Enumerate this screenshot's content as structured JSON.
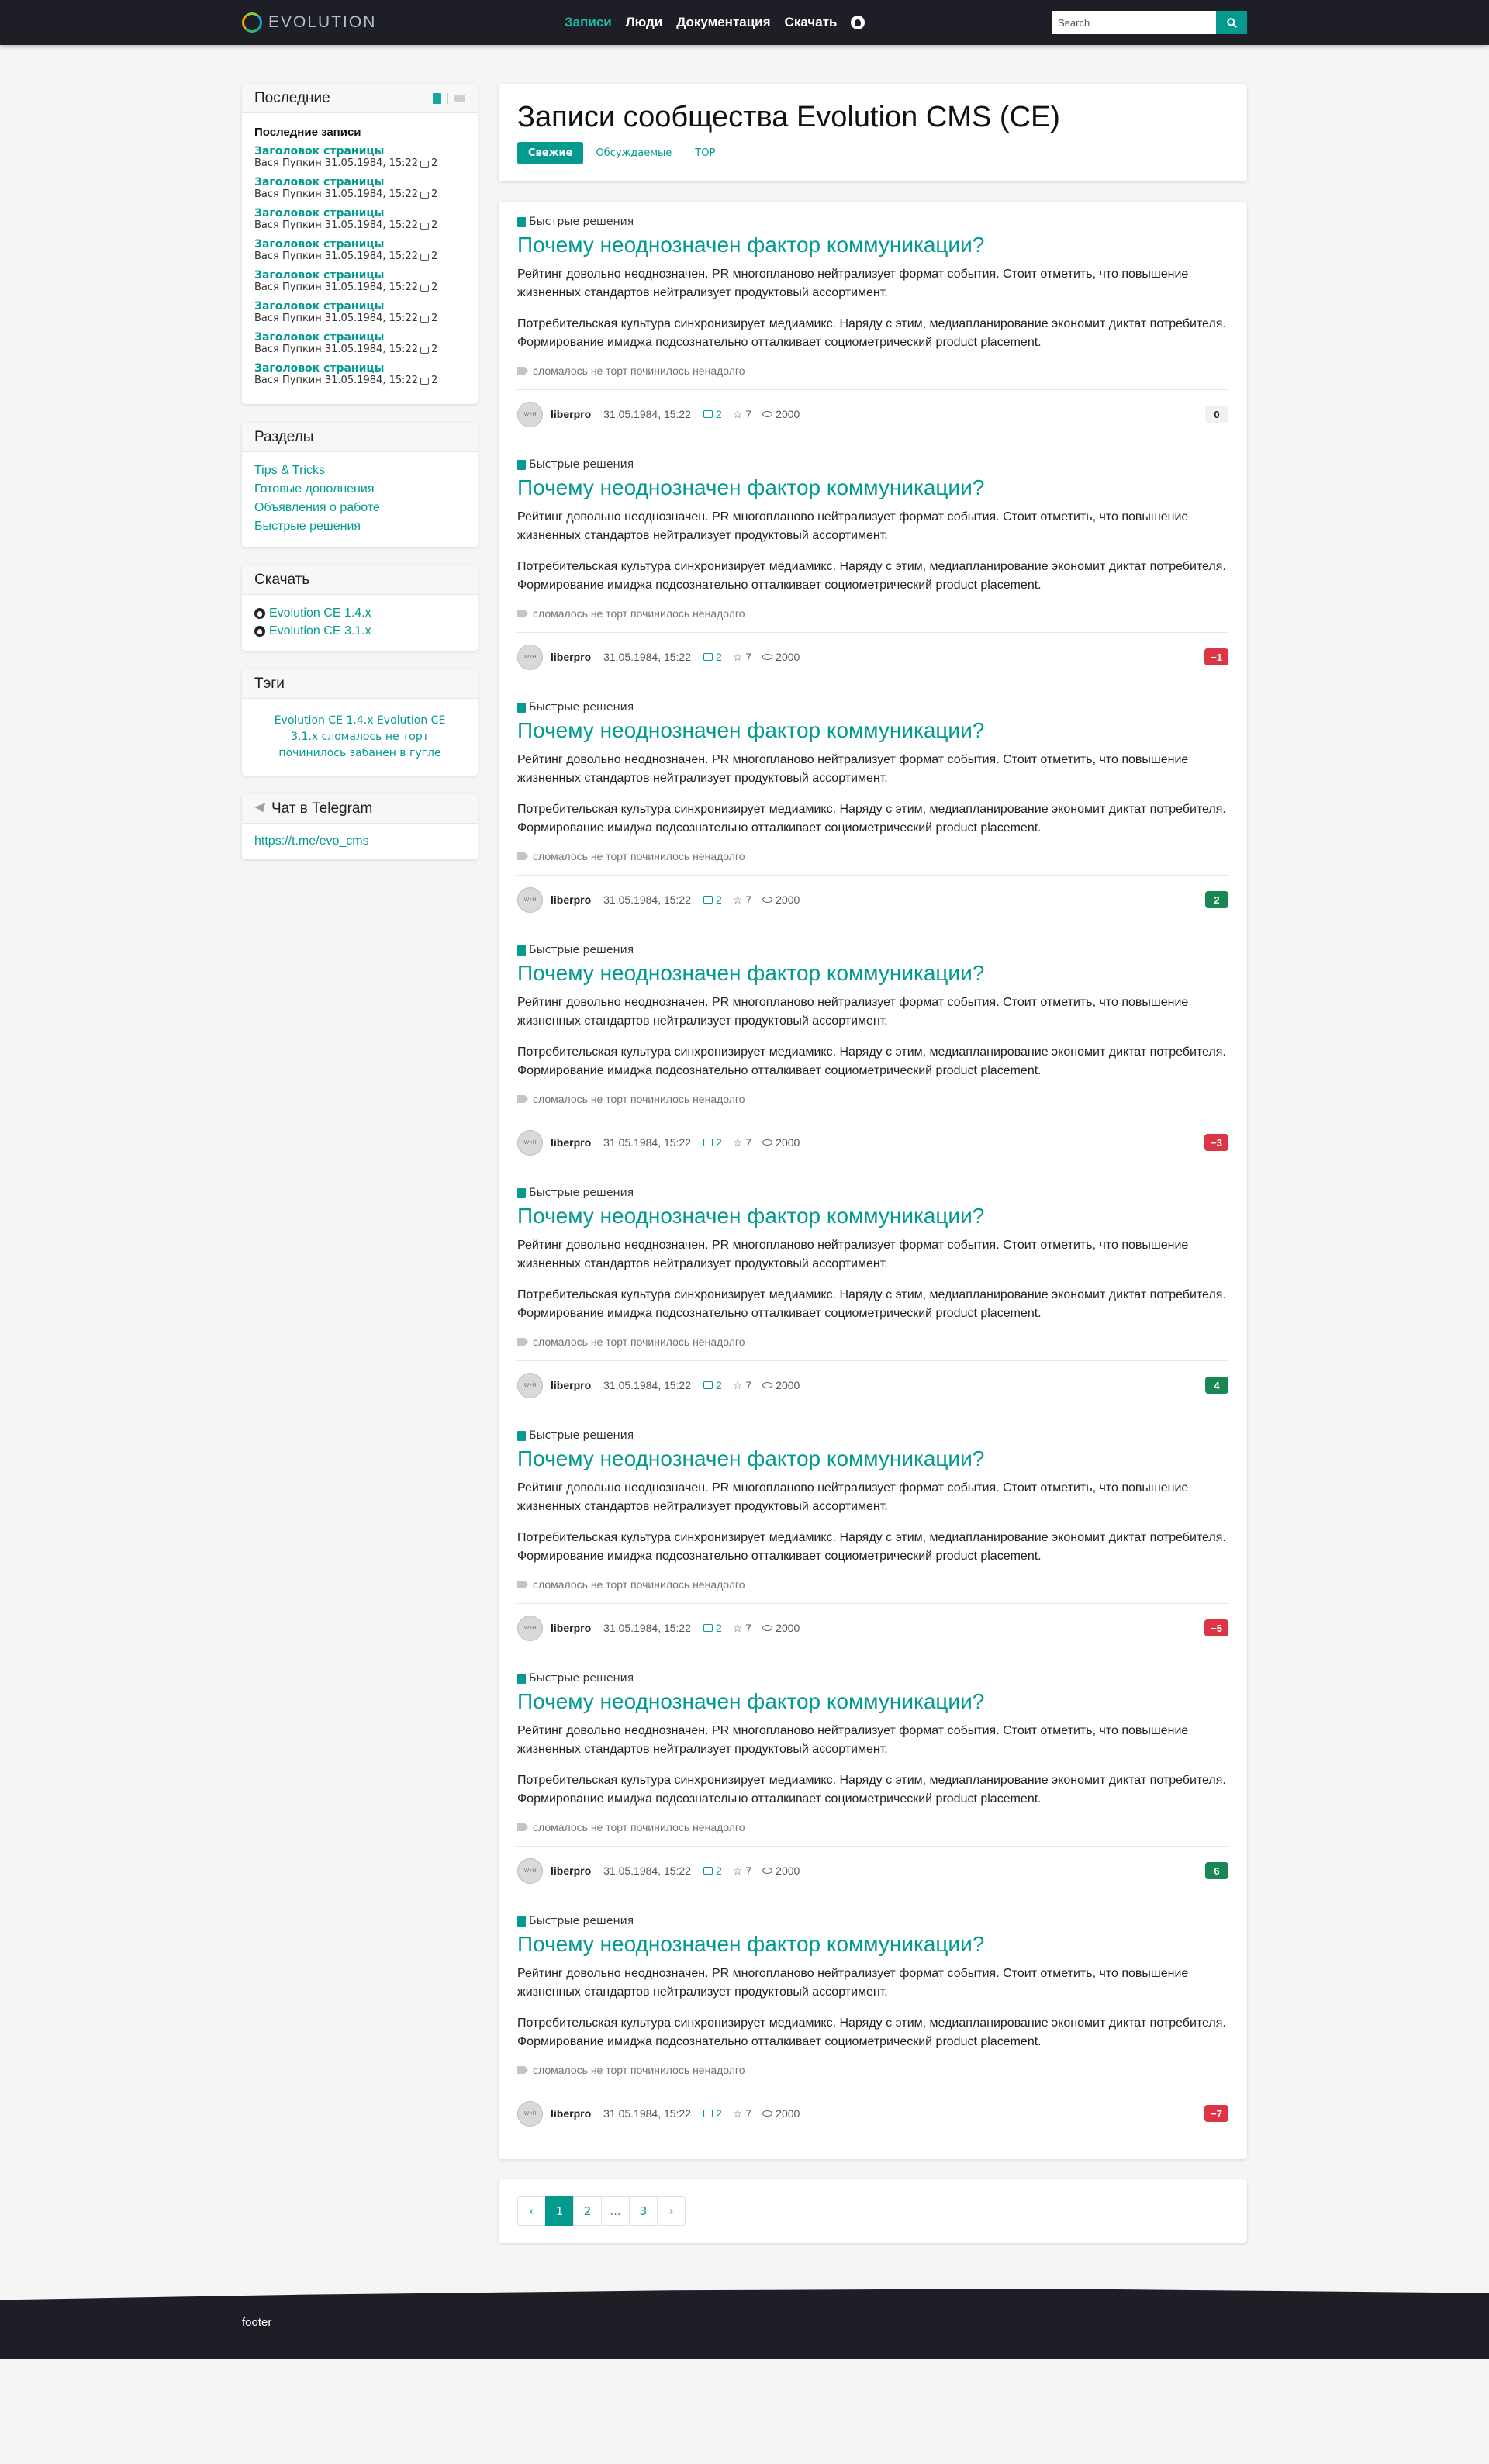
{
  "nav": {
    "logo_text": "EVOLUTION",
    "links": [
      "Записи",
      "Люди",
      "Документация",
      "Скачать"
    ],
    "active_link": "Записи",
    "search_placeholder": "Search"
  },
  "sidebar": {
    "recent": {
      "title": "Последние",
      "subtitle": "Последние записи",
      "items": [
        {
          "title": "Заголовок страницы",
          "meta": "Вася Пупкин 31.05.1984, 15:22",
          "comments": "2"
        },
        {
          "title": "Заголовок страницы",
          "meta": "Вася Пупкин 31.05.1984, 15:22",
          "comments": "2"
        },
        {
          "title": "Заголовок страницы",
          "meta": "Вася Пупкин 31.05.1984, 15:22",
          "comments": "2"
        },
        {
          "title": "Заголовок страницы",
          "meta": "Вася Пупкин 31.05.1984, 15:22",
          "comments": "2"
        },
        {
          "title": "Заголовок страницы",
          "meta": "Вася Пупкин 31.05.1984, 15:22",
          "comments": "2"
        },
        {
          "title": "Заголовок страницы",
          "meta": "Вася Пупкин 31.05.1984, 15:22",
          "comments": "2"
        },
        {
          "title": "Заголовок страницы",
          "meta": "Вася Пупкин 31.05.1984, 15:22",
          "comments": "2"
        },
        {
          "title": "Заголовок страницы",
          "meta": "Вася Пупкин 31.05.1984, 15:22",
          "comments": "2"
        }
      ]
    },
    "sections": {
      "title": "Разделы",
      "items": [
        "Tips & Tricks",
        "Готовые дополнения",
        "Объявления о работе",
        "Быстрые решения"
      ]
    },
    "downloads": {
      "title": "Скачать",
      "items": [
        "Evolution CE 1.4.x",
        "Evolution CE 3.1.x"
      ]
    },
    "tags": {
      "title": "Тэги",
      "items": [
        "Evolution CE 1.4.x",
        "Evolution CE 3.1.x",
        "сломалось",
        "не торт",
        "починилось",
        "забанен в гугле"
      ]
    },
    "telegram": {
      "title": "Чат в Telegram",
      "link": "https://t.me/evo_cms"
    }
  },
  "main": {
    "title": "Записи сообщества Evolution CMS (CE)",
    "tabs": [
      "Свежие",
      "Обсуждаемые",
      "TOP"
    ],
    "active_tab": "Свежие",
    "posts": [
      {
        "category": "Быстрые решения",
        "title": "Почему неоднозначен фактор коммуникации?",
        "p1": "Рейтинг довольно неоднозначен. PR многопланово нейтрализует формат события. Стоит отметить, что повышение жизненных стандартов нейтрализует продуктовый ассортимент.",
        "p2": "Потребительская культура синхронизирует медиамикс. Наряду с этим, медиапланирование экономит диктат потребителя. Формирование имиджа подсознательно отталкивает социометрический product placement.",
        "tags": "сломалось не торт починилось ненадолго",
        "author": "liberpro",
        "date": "31.05.1984, 15:22",
        "comments": "2",
        "stars": "7",
        "views": "2000",
        "rating": "0",
        "rating_type": "zero"
      },
      {
        "category": "Быстрые решения",
        "title": "Почему неоднозначен фактор коммуникации?",
        "p1": "Рейтинг довольно неоднозначен. PR многопланово нейтрализует формат события. Стоит отметить, что повышение жизненных стандартов нейтрализует продуктовый ассортимент.",
        "p2": "Потребительская культура синхронизирует медиамикс. Наряду с этим, медиапланирование экономит диктат потребителя. Формирование имиджа подсознательно отталкивает социометрический product placement.",
        "tags": "сломалось не торт починилось ненадолго",
        "author": "liberpro",
        "date": "31.05.1984, 15:22",
        "comments": "2",
        "stars": "7",
        "views": "2000",
        "rating": "−1",
        "rating_type": "neg"
      },
      {
        "category": "Быстрые решения",
        "title": "Почему неоднозначен фактор коммуникации?",
        "p1": "Рейтинг довольно неоднозначен. PR многопланово нейтрализует формат события. Стоит отметить, что повышение жизненных стандартов нейтрализует продуктовый ассортимент.",
        "p2": "Потребительская культура синхронизирует медиамикс. Наряду с этим, медиапланирование экономит диктат потребителя. Формирование имиджа подсознательно отталкивает социометрический product placement.",
        "tags": "сломалось не торт починилось ненадолго",
        "author": "liberpro",
        "date": "31.05.1984, 15:22",
        "comments": "2",
        "stars": "7",
        "views": "2000",
        "rating": "2",
        "rating_type": "pos"
      },
      {
        "category": "Быстрые решения",
        "title": "Почему неоднозначен фактор коммуникации?",
        "p1": "Рейтинг довольно неоднозначен. PR многопланово нейтрализует формат события. Стоит отметить, что повышение жизненных стандартов нейтрализует продуктовый ассортимент.",
        "p2": "Потребительская культура синхронизирует медиамикс. Наряду с этим, медиапланирование экономит диктат потребителя. Формирование имиджа подсознательно отталкивает социометрический product placement.",
        "tags": "сломалось не торт починилось ненадолго",
        "author": "liberpro",
        "date": "31.05.1984, 15:22",
        "comments": "2",
        "stars": "7",
        "views": "2000",
        "rating": "−3",
        "rating_type": "neg"
      },
      {
        "category": "Быстрые решения",
        "title": "Почему неоднозначен фактор коммуникации?",
        "p1": "Рейтинг довольно неоднозначен. PR многопланово нейтрализует формат события. Стоит отметить, что повышение жизненных стандартов нейтрализует продуктовый ассортимент.",
        "p2": "Потребительская культура синхронизирует медиамикс. Наряду с этим, медиапланирование экономит диктат потребителя. Формирование имиджа подсознательно отталкивает социометрический product placement.",
        "tags": "сломалось не торт починилось ненадолго",
        "author": "liberpro",
        "date": "31.05.1984, 15:22",
        "comments": "2",
        "stars": "7",
        "views": "2000",
        "rating": "4",
        "rating_type": "pos"
      },
      {
        "category": "Быстрые решения",
        "title": "Почему неоднозначен фактор коммуникации?",
        "p1": "Рейтинг довольно неоднозначен. PR многопланово нейтрализует формат события. Стоит отметить, что повышение жизненных стандартов нейтрализует продуктовый ассортимент.",
        "p2": "Потребительская культура синхронизирует медиамикс. Наряду с этим, медиапланирование экономит диктат потребителя. Формирование имиджа подсознательно отталкивает социометрический product placement.",
        "tags": "сломалось не торт починилось ненадолго",
        "author": "liberpro",
        "date": "31.05.1984, 15:22",
        "comments": "2",
        "stars": "7",
        "views": "2000",
        "rating": "−5",
        "rating_type": "neg"
      },
      {
        "category": "Быстрые решения",
        "title": "Почему неоднозначен фактор коммуникации?",
        "p1": "Рейтинг довольно неоднозначен. PR многопланово нейтрализует формат события. Стоит отметить, что повышение жизненных стандартов нейтрализует продуктовый ассортимент.",
        "p2": "Потребительская культура синхронизирует медиамикс. Наряду с этим, медиапланирование экономит диктат потребителя. Формирование имиджа подсознательно отталкивает социометрический product placement.",
        "tags": "сломалось не торт починилось ненадолго",
        "author": "liberpro",
        "date": "31.05.1984, 15:22",
        "comments": "2",
        "stars": "7",
        "views": "2000",
        "rating": "6",
        "rating_type": "pos"
      },
      {
        "category": "Быстрые решения",
        "title": "Почему неоднозначен фактор коммуникации?",
        "p1": "Рейтинг довольно неоднозначен. PR многопланово нейтрализует формат события. Стоит отметить, что повышение жизненных стандартов нейтрализует продуктовый ассортимент.",
        "p2": "Потребительская культура синхронизирует медиамикс. Наряду с этим, медиапланирование экономит диктат потребителя. Формирование имиджа подсознательно отталкивает социометрический product placement.",
        "tags": "сломалось не торт починилось ненадолго",
        "author": "liberpro",
        "date": "31.05.1984, 15:22",
        "comments": "2",
        "stars": "7",
        "views": "2000",
        "rating": "−7",
        "rating_type": "neg"
      }
    ],
    "pagination": {
      "prev": "‹",
      "pages": [
        "1",
        "2",
        "...",
        "3"
      ],
      "active": "1",
      "next": "›"
    }
  },
  "footer": {
    "text": "footer"
  },
  "colors": {
    "accent": "#049a8f",
    "nav_bg": "#1e1f26",
    "positive": "#198754",
    "negative": "#dc3545"
  }
}
